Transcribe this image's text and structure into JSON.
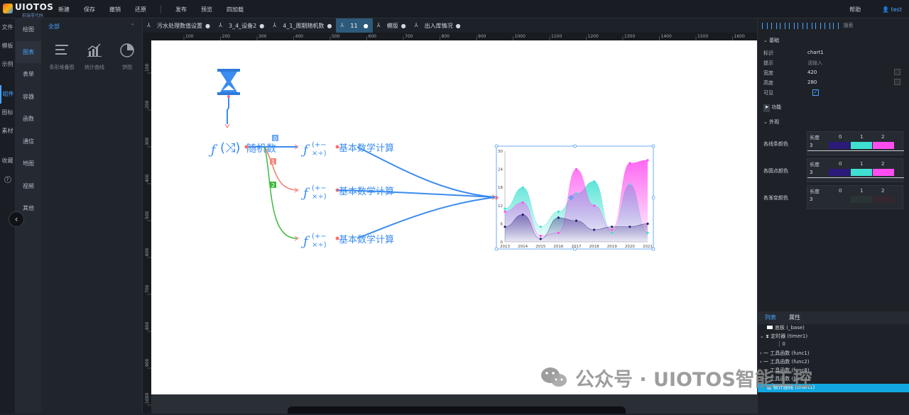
{
  "app": {
    "logo": "UIOTOS",
    "logo_sub": "前端零代码",
    "menu": [
      "新建",
      "保存",
      "撤销",
      "还原",
      "发布",
      "预览",
      "四加载"
    ],
    "help": "帮助",
    "user": "test"
  },
  "leftnav": [
    "文件",
    "模板",
    "示例",
    "组件",
    "图标",
    "素材",
    "收藏"
  ],
  "subnav": [
    "绘图",
    "图表",
    "表单",
    "容器",
    "函数",
    "通信",
    "地图",
    "视频",
    "其他"
  ],
  "palette": {
    "header": "全部",
    "items": [
      {
        "label": "条形堆叠图",
        "icon": "bar-stack-icon"
      },
      {
        "label": "统计曲线",
        "icon": "stat-curve-icon"
      },
      {
        "label": "饼图",
        "icon": "pie-icon"
      }
    ]
  },
  "tabs": [
    {
      "label": "污水处理数值设置"
    },
    {
      "label": "3_4_设备2"
    },
    {
      "label": "4_1_周期随机数"
    },
    {
      "label": "11",
      "active": true
    },
    {
      "label": "模版"
    },
    {
      "label": "出入库情况"
    }
  ],
  "ruler": {
    "top": [
      "100",
      "200",
      "300",
      "400",
      "500",
      "600",
      "700",
      "800",
      "900",
      "1000",
      "1100",
      "1200",
      "1300",
      "1400",
      "1500",
      "1600"
    ],
    "left": [
      "100",
      "200",
      "300",
      "400",
      "500",
      "600",
      "700",
      "800",
      "900",
      "1000"
    ]
  },
  "canvas": {
    "nodes": {
      "random": "随机数",
      "calc1": "基本数学计算",
      "calc2": "基本数学计算",
      "calc3": "基本数学计算"
    },
    "port_labels": [
      "0",
      "1",
      "2"
    ]
  },
  "chart_data": {
    "type": "area",
    "categories": [
      "2013",
      "2014",
      "2015",
      "2016",
      "2017",
      "2018",
      "2019",
      "2020",
      "2021"
    ],
    "ylim": [
      0,
      30
    ],
    "yticks": [
      "0",
      "6",
      "12",
      "18",
      "24",
      "30"
    ],
    "series": [
      {
        "values": [
          11,
          18,
          5,
          10,
          16,
          20,
          3,
          19,
          3
        ],
        "color": "#3fe0d0"
      },
      {
        "values": [
          10,
          13,
          2,
          3,
          24,
          12,
          4,
          26,
          27
        ],
        "color": "#ff4df0"
      },
      {
        "values": [
          5,
          9,
          1,
          8,
          7,
          4,
          5,
          5,
          6
        ],
        "color": "#2b1a7a"
      }
    ]
  },
  "props": {
    "section_base": "基础",
    "rows": [
      {
        "key": "标识",
        "value": "chart1"
      },
      {
        "key": "提示",
        "value": "请输入"
      },
      {
        "key": "宽度",
        "value": "420"
      },
      {
        "key": "高度",
        "value": "280"
      },
      {
        "key": "可见",
        "value": ""
      }
    ],
    "section_func": "功能",
    "section_look": "外观",
    "color_tables": [
      {
        "label": "各线条颜色",
        "len_header": "长度",
        "len": "3",
        "idx": [
          "0",
          "1",
          "2"
        ],
        "colors": [
          "#2b1a7a",
          "#3fe0d0",
          "#ff4df0"
        ]
      },
      {
        "label": "各圆点颜色",
        "len_header": "长度",
        "len": "3",
        "idx": [
          "0",
          "1",
          "2"
        ],
        "colors": [
          "#2b1a7a",
          "#3fe0d0",
          "#ff4df0"
        ]
      },
      {
        "label": "各渐变颜色",
        "len_header": "长度",
        "len": "3",
        "idx": [
          "0",
          "1",
          "2"
        ],
        "colors": [
          "#262b32",
          "#2a3436",
          "#33262f"
        ]
      }
    ],
    "align_search": "搜索"
  },
  "panel": {
    "tab_list": "列表",
    "tab_attr": "属性",
    "tree": [
      {
        "label": "底板 (_base)"
      },
      {
        "label": "定时器 (timer1)"
      },
      {
        "label": "0"
      },
      {
        "label": "工具函数 (func1)"
      },
      {
        "label": "工具函数 (func2)"
      },
      {
        "label": "工具函数 (func3)"
      },
      {
        "label": "工具函数 (func4)"
      },
      {
        "label": "统计曲线 (chart1)",
        "selected": true
      }
    ]
  },
  "watermark": "公众号 · UIOTOS智能工控"
}
